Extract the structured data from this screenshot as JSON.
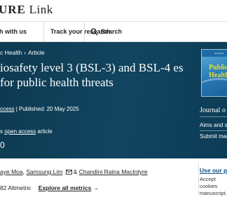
{
  "brand": {
    "logo_bold": "URE",
    "logo_link": "Link"
  },
  "nav": {
    "publish_label": "h with us",
    "track_label": "Track your research",
    "search_label": "Search"
  },
  "breadcrumb": {
    "journal": "c Health",
    "type": "Article"
  },
  "article": {
    "title": "iosafety level 3 (BSL-3) and BSL-4 es for public health threats",
    "access": "ccess",
    "published": "Published: 20 May 2025",
    "oa_prefix": "s ",
    "oa_link": "open access",
    "oa_suffix": " article",
    "partial_number": "0"
  },
  "authors": {
    "first": "aye Moa",
    "second": "Samsung Lim",
    "corresponding": "Chandini Raina MacIntyre"
  },
  "metrics": {
    "altmetric": "82  Altmetric",
    "explore": "Explore all metrics",
    "arrow": "→"
  },
  "sidebar": {
    "cover_top": "Journal of",
    "cover_word1": "Public",
    "cover_word2": "Health",
    "journal_link": "Journal o",
    "aims": "Aims and sc",
    "submit": "Submit man",
    "prefs_title": "Use our pre",
    "prefs_text": "Accept cookies manuscript."
  },
  "colors": {
    "hero": "#114560",
    "link": "#0b4f80"
  }
}
